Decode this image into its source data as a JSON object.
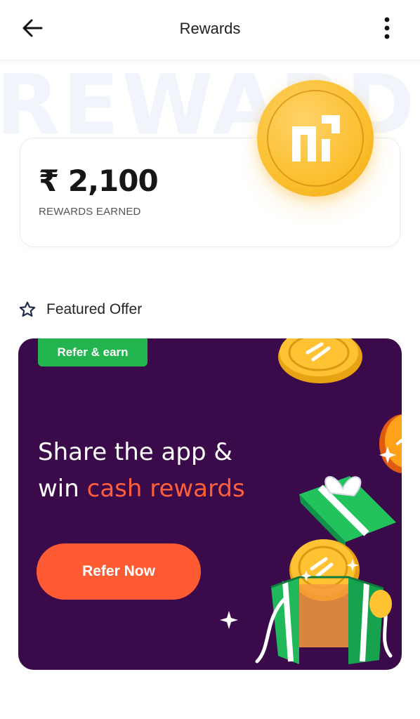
{
  "header": {
    "title": "Rewards",
    "back_icon": "arrow-left-icon",
    "menu_icon": "more-vertical-icon"
  },
  "background_watermark": "REWARDS",
  "rewards": {
    "amount": "₹ 2,100",
    "label": "REWARDS EARNED"
  },
  "featured": {
    "icon": "star-outline-icon",
    "label": "Featured Offer"
  },
  "banner": {
    "tag": "Refer & earn",
    "headline_line1": "Share the app &",
    "headline_prefix": "win ",
    "headline_accent": "cash rewards",
    "cta": "Refer Now",
    "colors": {
      "background": "#3a0a4a",
      "tag": "#23b34f",
      "accent": "#ff5e3a",
      "cta": "#ff5b33"
    }
  }
}
